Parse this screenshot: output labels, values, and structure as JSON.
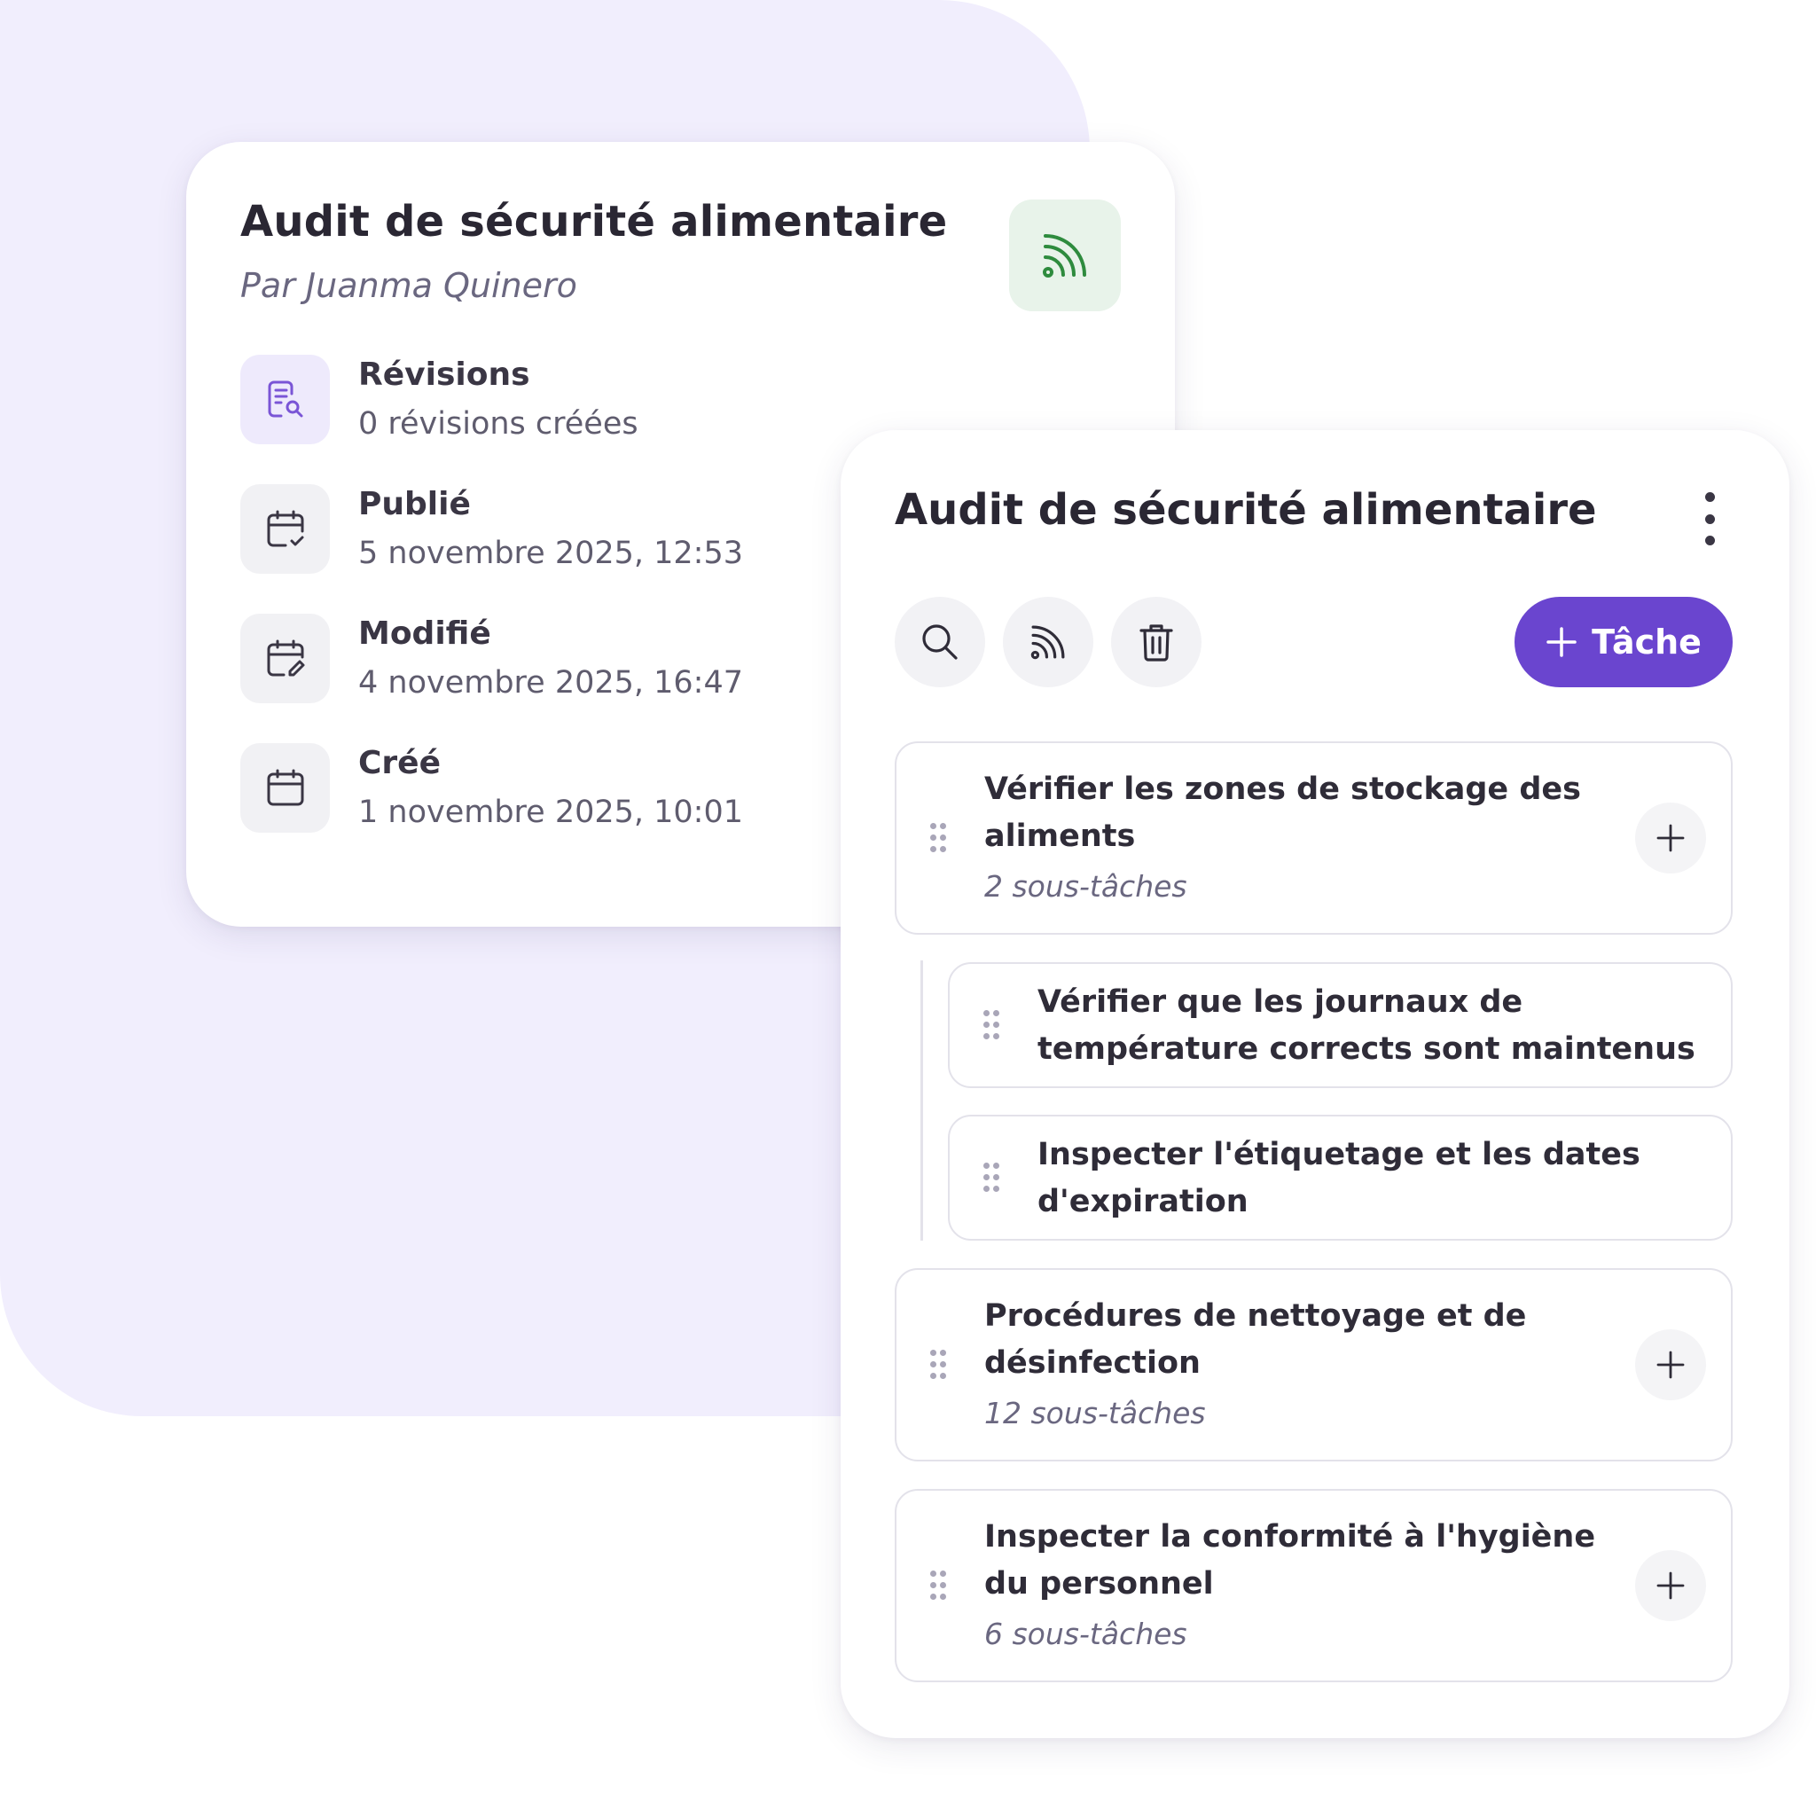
{
  "info_card": {
    "title": "Audit de sécurité alimentaire",
    "author": "Par Juanma Quinero",
    "feed_icon": "rss-feed-icon",
    "rows": [
      {
        "label": "Révisions",
        "value": "0 révisions créées",
        "icon": "document-search-icon"
      },
      {
        "label": "Publié",
        "value": "5 novembre 2025, 12:53",
        "icon": "calendar-check-icon"
      },
      {
        "label": "Modifié",
        "value": "4 novembre 2025, 16:47",
        "icon": "calendar-edit-icon"
      },
      {
        "label": "Créé",
        "value": "1 novembre 2025, 10:01",
        "icon": "calendar-icon"
      }
    ]
  },
  "tasks_card": {
    "title": "Audit de sécurité alimentaire",
    "menu_icon": "kebab-menu-icon",
    "toolbar": {
      "search_icon": "search-icon",
      "feed_icon": "rss-feed-icon",
      "delete_icon": "trash-icon",
      "add_task_label": "Tâche"
    },
    "tasks": [
      {
        "title": "Vérifier les zones de stockage des aliments",
        "subtasks_label": "2 sous-tâches",
        "subtasks": [
          {
            "title": "Vérifier que les journaux de température corrects sont maintenus"
          },
          {
            "title": "Inspecter l'étiquetage et les dates d'expiration"
          }
        ]
      },
      {
        "title": "Procédures de nettoyage et de désinfection",
        "subtasks_label": "12 sous-tâches"
      },
      {
        "title": "Inspecter la conformité à l'hygiène du personnel",
        "subtasks_label": "6 sous-tâches"
      }
    ]
  },
  "colors": {
    "background_blob": "#f1eefd",
    "accent": "#6a45cf",
    "feed_green": "#2e8b3e",
    "feed_badge_bg": "#e8f3ea",
    "icon_purple": "#7a55d6"
  }
}
